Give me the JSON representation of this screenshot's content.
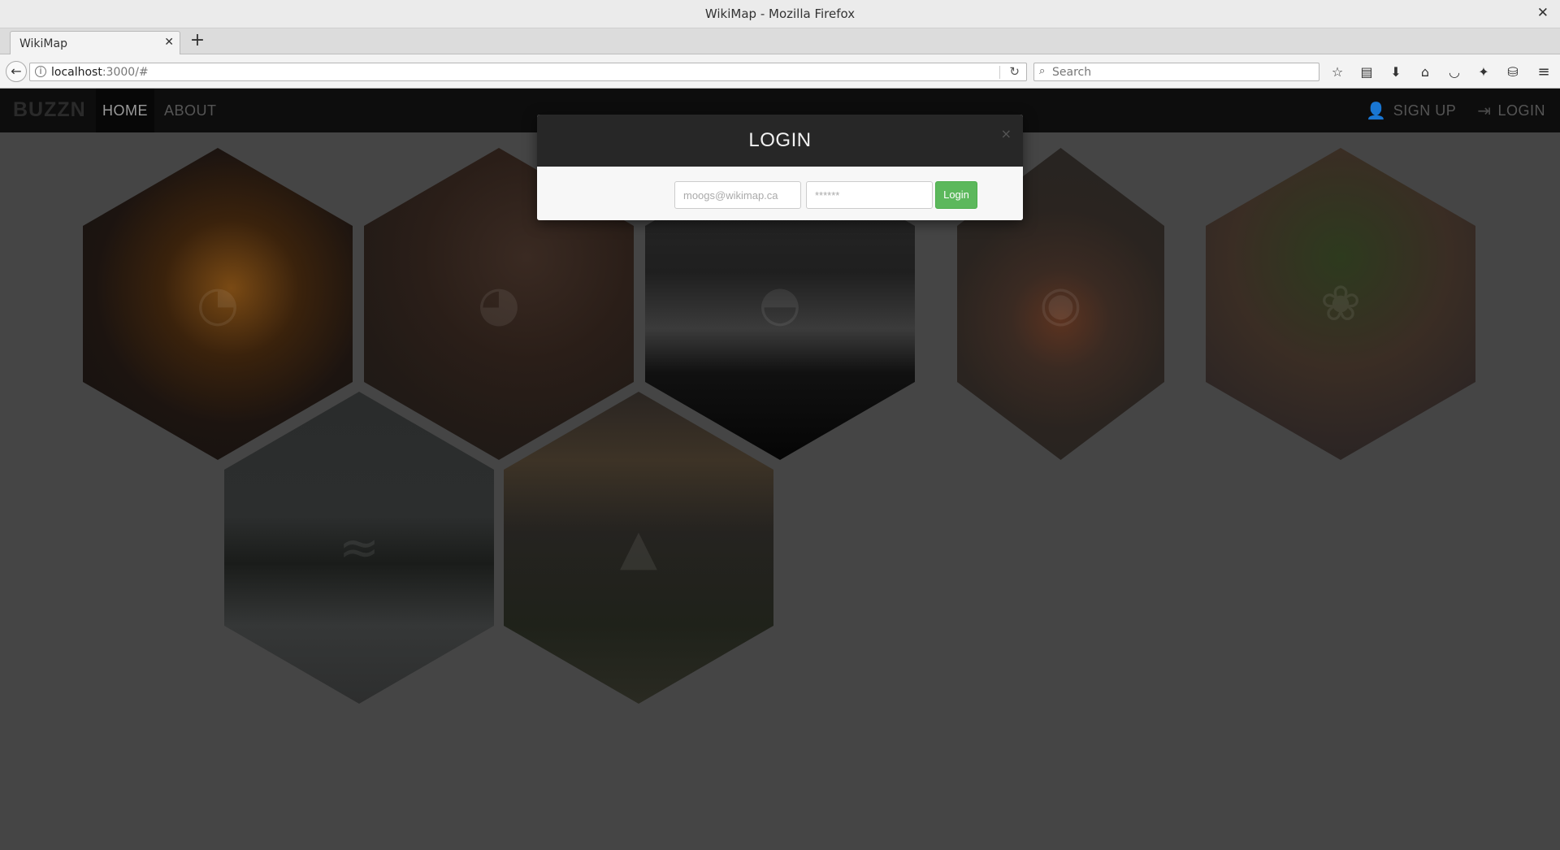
{
  "window": {
    "title": "WikiMap - Mozilla Firefox",
    "close_glyph": "✕"
  },
  "tabs": [
    {
      "label": "WikiMap",
      "close_glyph": "✕"
    }
  ],
  "newtab_glyph": "+",
  "addressbar": {
    "host": "localhost",
    "rest": ":3000/#"
  },
  "searchbar": {
    "placeholder": "Search"
  },
  "toolbar_icons": [
    "bookmark-star-icon",
    "reading-list-icon",
    "download-icon",
    "home-icon",
    "pocket-icon",
    "extension-icon",
    "screenshot-icon",
    "menu-icon"
  ],
  "app": {
    "brand": "BUZZN",
    "nav": {
      "home": "HOME",
      "about": "ABOUT",
      "signup": "SIGN UP",
      "login": "LOGIN"
    }
  },
  "hexes": [
    {
      "subject": "beer glasses"
    },
    {
      "subject": "coffee beans"
    },
    {
      "subject": "diver silhouette over water"
    },
    {
      "subject": "soup on cutting board"
    },
    {
      "subject": "charcuterie platter"
    },
    {
      "subject": "misty lake"
    },
    {
      "subject": "hiker at sunset"
    }
  ],
  "modal": {
    "title": "LOGIN",
    "close_glyph": "×",
    "email_placeholder": "moogs@wikimap.ca",
    "password_placeholder": "******",
    "submit_label": "Login"
  },
  "colors": {
    "accent_green": "#5cb85c",
    "app_nav_bg": "#0d0d0d",
    "overlay_bg": "#454545"
  }
}
